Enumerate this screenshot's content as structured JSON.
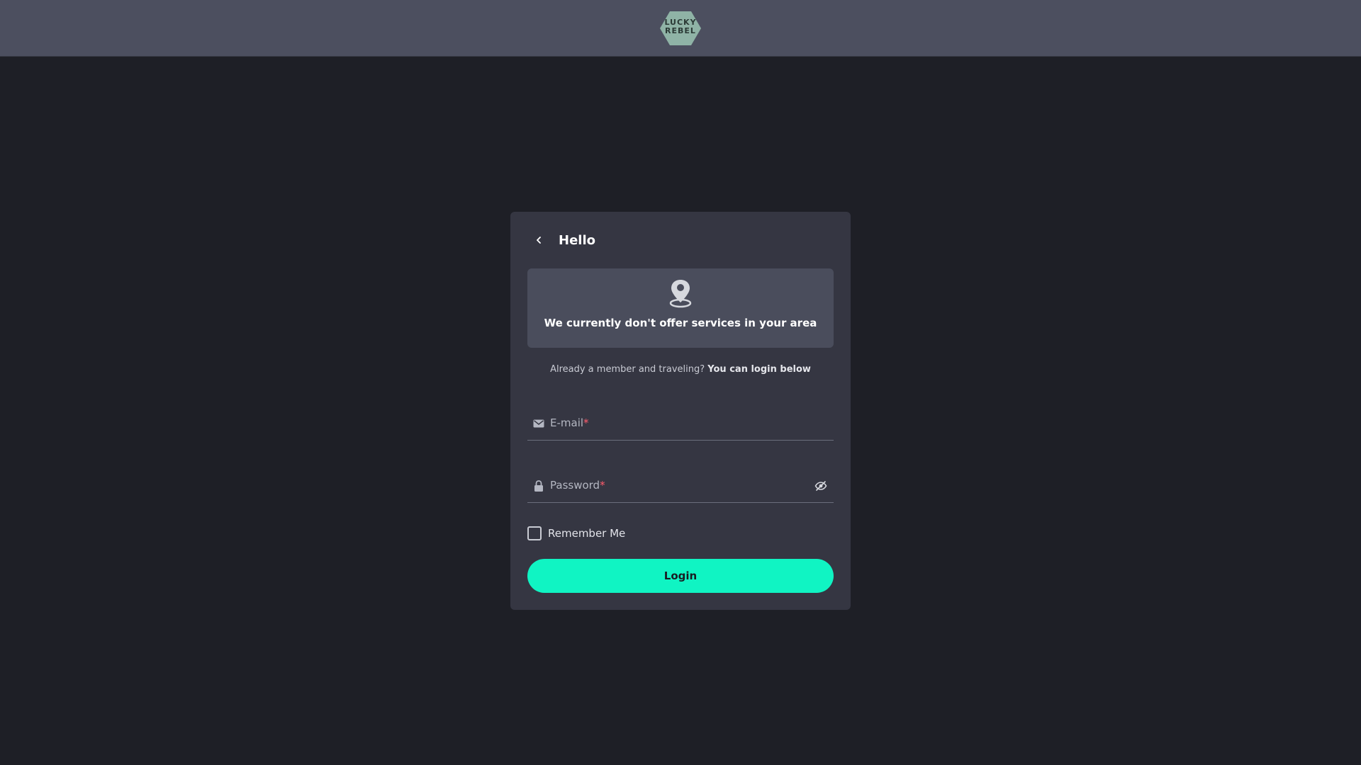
{
  "header": {
    "logo_line1": "LUCKY",
    "logo_line2": "REBEL"
  },
  "card": {
    "title": "Hello",
    "notice": "We currently don't offer services in your area",
    "member_text": "Already a member and traveling?",
    "member_cta": "You can login below",
    "email": {
      "label": "E-mail",
      "value": ""
    },
    "password": {
      "label": "Password",
      "value": ""
    },
    "required_marker": "*",
    "remember_label": "Remember Me",
    "remember_checked": false,
    "login_label": "Login"
  },
  "colors": {
    "accent": "#10f4c3",
    "background": "#1e1f26",
    "card": "#353642",
    "topbar": "#4c4f5f",
    "notice": "#4a4d5c"
  },
  "icons": [
    "back-icon",
    "location-pin-icon",
    "mail-icon",
    "lock-icon",
    "eye-off-icon"
  ]
}
